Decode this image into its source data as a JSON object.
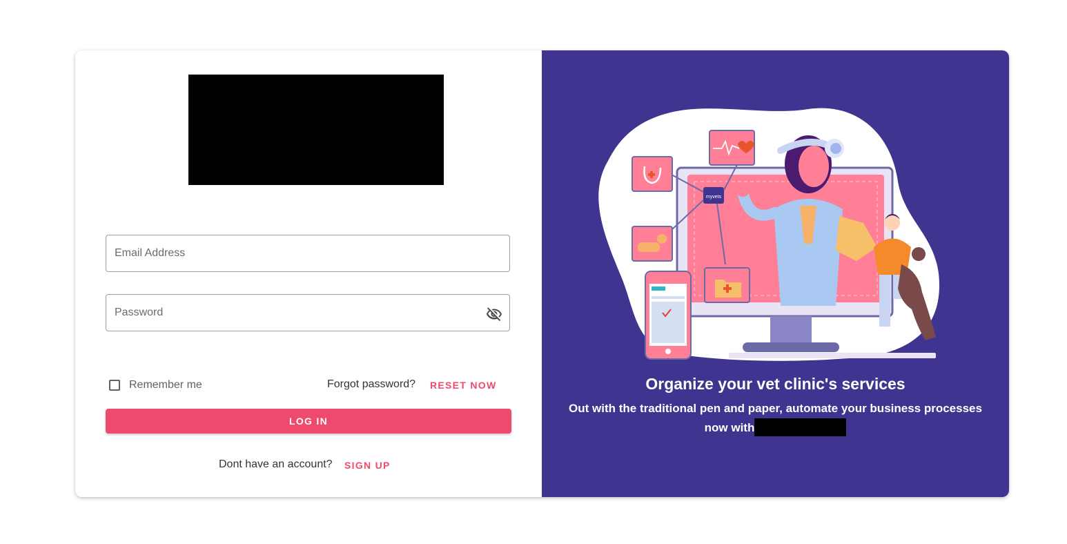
{
  "login": {
    "email_placeholder": "Email Address",
    "password_placeholder": "Password",
    "remember_label": "Remember me",
    "forgot_text": "Forgot password?",
    "reset_label": "RESET NOW",
    "login_label": "LOG IN",
    "no_account_text": "Dont have an account?",
    "signup_label": "SIGN UP"
  },
  "promo": {
    "headline": "Organize your vet clinic's services",
    "subline_part1": "Out with the traditional pen and paper, automate your business processes now with",
    "badge_text": "myvets"
  },
  "colors": {
    "accent": "#ee4a6e",
    "panel": "#3f3590",
    "screen": "#fe7f96"
  },
  "icons": {
    "password_toggle": "eye-off-icon"
  }
}
